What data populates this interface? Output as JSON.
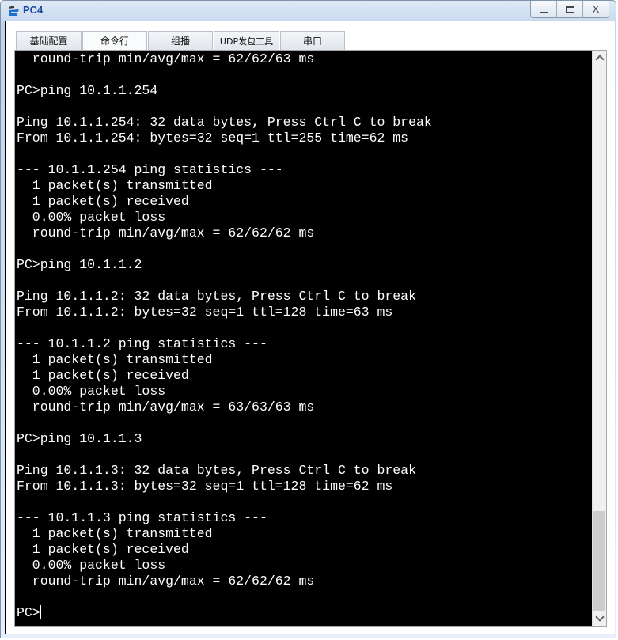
{
  "window": {
    "title": "PC4",
    "app_icon": "network-device-icon",
    "controls": {
      "minimize": "minimize",
      "maximize": "maximize",
      "close": "X"
    }
  },
  "tabs": [
    {
      "label": "基础配置",
      "active": false
    },
    {
      "label": "命令行",
      "active": true
    },
    {
      "label": "组播",
      "active": false
    },
    {
      "label": "UDP发包工具",
      "active": false
    },
    {
      "label": "串口",
      "active": false
    }
  ],
  "terminal": {
    "lines": [
      "  round-trip min/avg/max = 62/62/63 ms",
      "",
      "PC>ping 10.1.1.254",
      "",
      "Ping 10.1.1.254: 32 data bytes, Press Ctrl_C to break",
      "From 10.1.1.254: bytes=32 seq=1 ttl=255 time=62 ms",
      "",
      "--- 10.1.1.254 ping statistics ---",
      "  1 packet(s) transmitted",
      "  1 packet(s) received",
      "  0.00% packet loss",
      "  round-trip min/avg/max = 62/62/62 ms",
      "",
      "PC>ping 10.1.1.2",
      "",
      "Ping 10.1.1.2: 32 data bytes, Press Ctrl_C to break",
      "From 10.1.1.2: bytes=32 seq=1 ttl=128 time=63 ms",
      "",
      "--- 10.1.1.2 ping statistics ---",
      "  1 packet(s) transmitted",
      "  1 packet(s) received",
      "  0.00% packet loss",
      "  round-trip min/avg/max = 63/63/63 ms",
      "",
      "PC>ping 10.1.1.3",
      "",
      "Ping 10.1.1.3: 32 data bytes, Press Ctrl_C to break",
      "From 10.1.1.3: bytes=32 seq=1 ttl=128 time=62 ms",
      "",
      "--- 10.1.1.3 ping statistics ---",
      "  1 packet(s) transmitted",
      "  1 packet(s) received",
      "  0.00% packet loss",
      "  round-trip min/avg/max = 62/62/62 ms",
      ""
    ],
    "prompt": "PC>",
    "input_value": "",
    "scroll_position_fraction": 1.0,
    "colors": {
      "background": "#000000",
      "foreground": "#ffffff"
    }
  }
}
